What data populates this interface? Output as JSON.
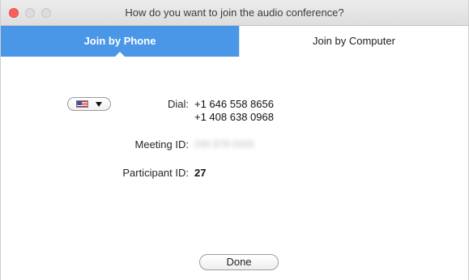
{
  "window": {
    "title": "How do you want to join the audio conference?"
  },
  "tabs": [
    {
      "label": "Join by Phone",
      "active": true
    },
    {
      "label": "Join by Computer",
      "active": false
    }
  ],
  "phone": {
    "country_flag": "us-flag-icon",
    "dial_label": "Dial:",
    "dial_numbers": [
      "+1 646 558 8656",
      "+1 408 638 0968"
    ],
    "meeting_id_label": "Meeting ID:",
    "meeting_id_value": "240 878 0326",
    "meeting_id_obscured": true,
    "participant_id_label": "Participant ID:",
    "participant_id_value": "27"
  },
  "footer": {
    "done_label": "Done"
  },
  "colors": {
    "accent": "#4a97e8",
    "close_button": "#fc605b"
  }
}
